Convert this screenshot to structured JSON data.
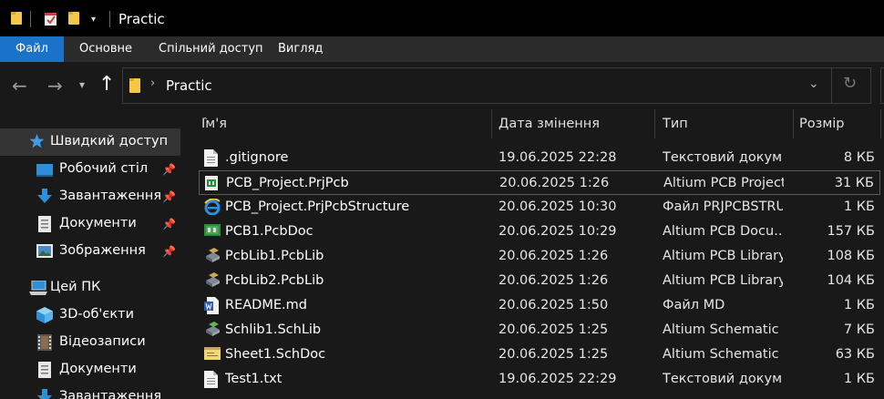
{
  "window": {
    "title": "Practic",
    "quick_access_toolbar": [
      "folder-icon",
      "checkmark-icon",
      "folder-icon",
      "chevron-down-icon"
    ]
  },
  "ribbon": {
    "tabs": [
      {
        "label": "Файл",
        "active": true
      },
      {
        "label": "Основне"
      },
      {
        "label": "Спільний доступ"
      },
      {
        "label": "Вигляд"
      }
    ]
  },
  "address": {
    "path": "Practic",
    "icons": {
      "back": "←",
      "forward": "→",
      "recent": "⌄",
      "up": "↑",
      "refresh": "↻",
      "dropdown": "⌄"
    }
  },
  "sidebar": {
    "items": [
      {
        "label": "Швидкий доступ",
        "icon": "star-icon",
        "selected": true
      },
      {
        "label": "Робочий стіл",
        "icon": "desktop-icon",
        "pinned": true
      },
      {
        "label": "Завантаження",
        "icon": "download-icon",
        "pinned": true
      },
      {
        "label": "Документи",
        "icon": "document-icon",
        "pinned": true
      },
      {
        "label": "Зображення",
        "icon": "pictures-icon",
        "pinned": true
      },
      {
        "label": "Цей ПК",
        "icon": "computer-icon"
      },
      {
        "label": "3D-об'єкти",
        "icon": "cube-icon"
      },
      {
        "label": "Відеозаписи",
        "icon": "film-icon"
      },
      {
        "label": "Документи",
        "icon": "document-icon"
      },
      {
        "label": "Завантаження",
        "icon": "download-icon"
      }
    ]
  },
  "columns": {
    "name": "Ім'я",
    "date": "Дата змінення",
    "type": "Тип",
    "size": "Розмір"
  },
  "files": [
    {
      "name": ".gitignore",
      "date": "19.06.2025 22:28",
      "type": "Текстовий докум...",
      "size": "8 КБ",
      "icon": "text-file-icon"
    },
    {
      "name": "PCB_Project.PrjPcb",
      "date": "20.06.2025 1:26",
      "type": "Altium PCB Project",
      "size": "31 КБ",
      "icon": "altium-project-icon",
      "selected": true
    },
    {
      "name": "PCB_Project.PrjPcbStructure",
      "date": "20.06.2025 10:30",
      "type": "Файл PRJPCBSTRU...",
      "size": "1 КБ",
      "icon": "internet-explorer-icon"
    },
    {
      "name": "PCB1.PcbDoc",
      "date": "20.06.2025 10:29",
      "type": "Altium PCB Docu...",
      "size": "157 КБ",
      "icon": "pcb-doc-icon"
    },
    {
      "name": "PcbLib1.PcbLib",
      "date": "20.06.2025 1:26",
      "type": "Altium PCB Library",
      "size": "108 КБ",
      "icon": "pcb-library-icon"
    },
    {
      "name": "PcbLib2.PcbLib",
      "date": "20.06.2025 1:26",
      "type": "Altium PCB Library",
      "size": "104 КБ",
      "icon": "pcb-library-icon"
    },
    {
      "name": "README.md",
      "date": "20.06.2025 1:50",
      "type": "Файл MD",
      "size": "1 КБ",
      "icon": "word-doc-icon"
    },
    {
      "name": "Schlib1.SchLib",
      "date": "20.06.2025 1:25",
      "type": "Altium Schematic ...",
      "size": "7 КБ",
      "icon": "sch-library-icon"
    },
    {
      "name": "Sheet1.SchDoc",
      "date": "20.06.2025 1:25",
      "type": "Altium Schematic ...",
      "size": "63 КБ",
      "icon": "sch-doc-icon"
    },
    {
      "name": "Test1.txt",
      "date": "19.06.2025 22:29",
      "type": "Текстовий докум...",
      "size": "1 КБ",
      "icon": "text-file-icon"
    }
  ],
  "colors": {
    "accent": "#1a73c8",
    "background": "#191919",
    "titlebar": "#000000",
    "ribbon": "#2b2b2b",
    "selected_sidebar": "#333333"
  }
}
